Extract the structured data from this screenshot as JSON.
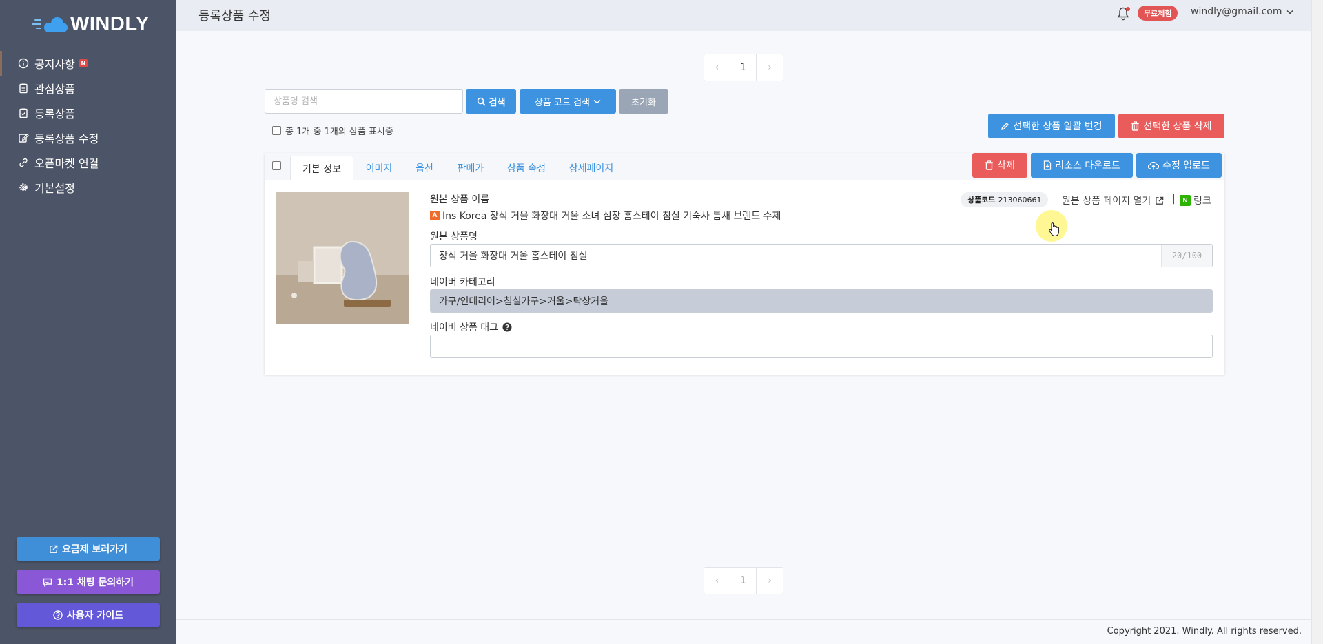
{
  "brand": {
    "name": "WINDLY"
  },
  "sidebar": {
    "items": [
      {
        "label": "공지사항",
        "icon": "info-icon",
        "badge": "N"
      },
      {
        "label": "관심상품",
        "icon": "clipboard-icon"
      },
      {
        "label": "등록상품",
        "icon": "clipboard-check-icon"
      },
      {
        "label": "등록상품 수정",
        "icon": "edit-icon"
      },
      {
        "label": "오픈마켓 연결",
        "icon": "link-icon"
      },
      {
        "label": "기본설정",
        "icon": "gear-icon"
      }
    ],
    "buttons": {
      "plan": "요금제 보러가기",
      "chat": "1:1 채팅 문의하기",
      "guide": "사용자 가이드"
    }
  },
  "header": {
    "title": "등록상품 수정",
    "trial_badge": "무료체험",
    "user_email": "windly@gmail.com"
  },
  "pagination": {
    "current": "1"
  },
  "search": {
    "placeholder": "상품명 검색",
    "search_button": "검색",
    "code_search_button": "상품 코드 검색",
    "reset_button": "초기화",
    "count_text": "총 1개 중 1개의 상품 표시중"
  },
  "actions": {
    "bulk_edit": "선택한 상품 일괄 변경",
    "delete_selected": "선택한 상품 삭제"
  },
  "product": {
    "tabs": [
      "기본 정보",
      "이미지",
      "옵션",
      "판매가",
      "상품 속성",
      "상세페이지"
    ],
    "buttons": {
      "delete": "삭제",
      "download": "리소스 다운로드",
      "upload": "수정 업로드"
    },
    "original_name_label": "원본 상품 이름",
    "original_name": "Ins Korea 장식 거울 화장대 거울 소녀 심장 홈스테이 침실 기숙사 틈새 브랜드 수제",
    "code_label": "상품코드",
    "code": "213060661",
    "open_original": "원본 상품 페이지 열기",
    "separator": "|",
    "naver_link": "링크",
    "name_label": "원본 상품명",
    "name_value": "장식 거울 화장대 거울 홈스테이 침실",
    "name_count": "20/100",
    "category_label": "네이버 카테고리",
    "category_value": "가구/인테리어>침실가구>거울>탁상거울",
    "tag_label": "네이버 상품 태그",
    "tag_value": ""
  },
  "footer": {
    "copyright": "Copyright 2021. Windly. All rights reserved."
  },
  "colors": {
    "sidebar_bg": "#4c5467",
    "primary": "#3d93df",
    "danger": "#ea5c5c",
    "reset": "#9aa5b5",
    "chat": "#8a58d6",
    "guide": "#6358d8"
  }
}
